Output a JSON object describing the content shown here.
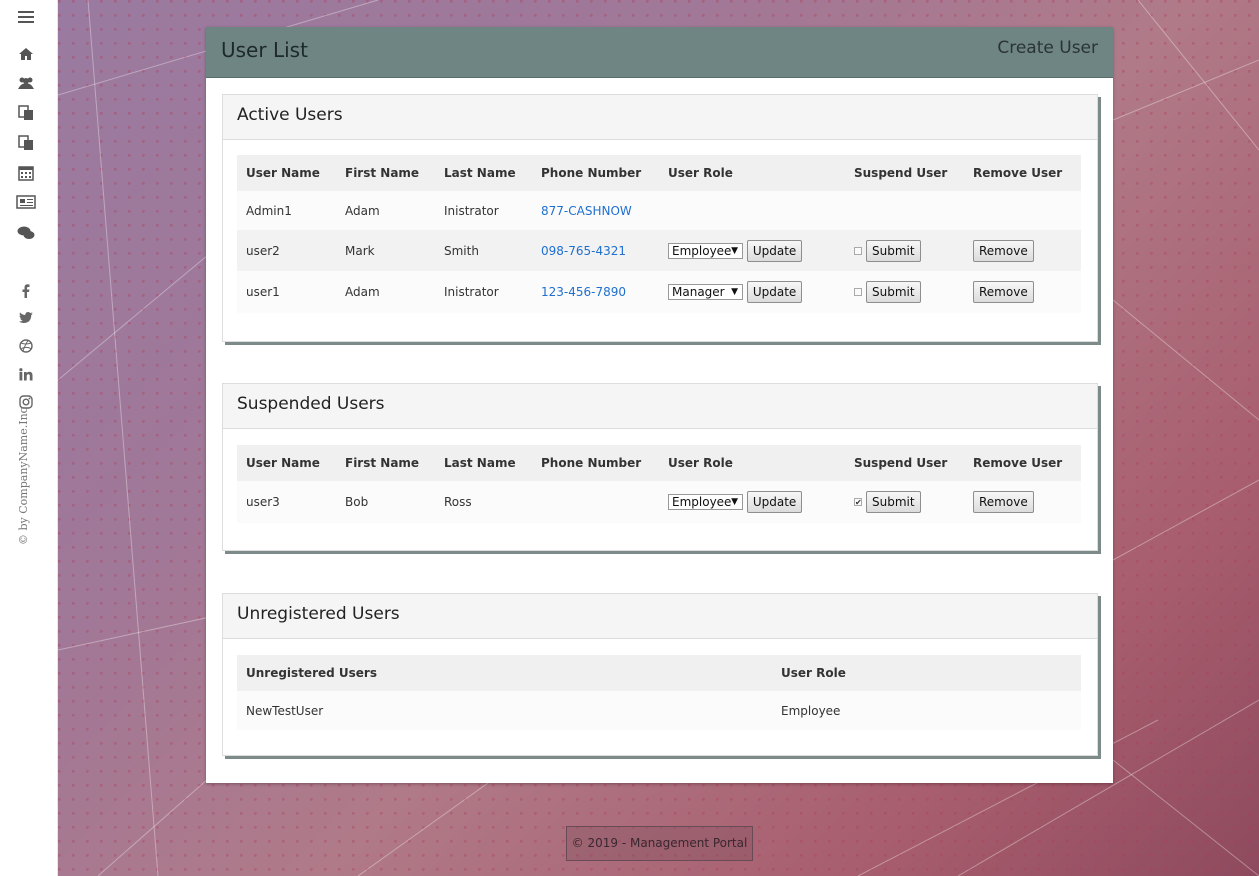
{
  "sidebar": {
    "copyright": "© by CompanyName.Inc"
  },
  "header": {
    "title": "User List",
    "create_user": "Create User"
  },
  "active": {
    "title": "Active Users",
    "columns": [
      "User Name",
      "First Name",
      "Last Name",
      "Phone Number",
      "User Role",
      "Suspend User",
      "Remove User"
    ],
    "rows": [
      {
        "username": "Admin1",
        "first": "Adam",
        "last": "Inistrator",
        "phone": "877-CASHNOW"
      },
      {
        "username": "user2",
        "first": "Mark",
        "last": "Smith",
        "phone": "098-765-4321",
        "role": "Employee",
        "update": "Update",
        "submit": "Submit",
        "remove": "Remove",
        "suspended": false
      },
      {
        "username": "user1",
        "first": "Adam",
        "last": "Inistrator",
        "phone": "123-456-7890",
        "role": "Manager",
        "update": "Update",
        "submit": "Submit",
        "remove": "Remove",
        "suspended": false
      }
    ]
  },
  "suspended": {
    "title": "Suspended Users",
    "columns": [
      "User Name",
      "First Name",
      "Last Name",
      "Phone Number",
      "User Role",
      "Suspend User",
      "Remove User"
    ],
    "rows": [
      {
        "username": "user3",
        "first": "Bob",
        "last": "Ross",
        "role": "Employee",
        "update": "Update",
        "submit": "Submit",
        "remove": "Remove",
        "suspended": true
      }
    ]
  },
  "unregistered": {
    "title": "Unregistered Users",
    "columns": [
      "Unregistered Users",
      "User Role"
    ],
    "rows": [
      {
        "username": "NewTestUser",
        "role": "Employee"
      }
    ]
  },
  "footer": {
    "text": "© 2019 - Management Portal"
  },
  "colors": {
    "header_bg": "#6f8583",
    "link": "#1f6fcf"
  }
}
